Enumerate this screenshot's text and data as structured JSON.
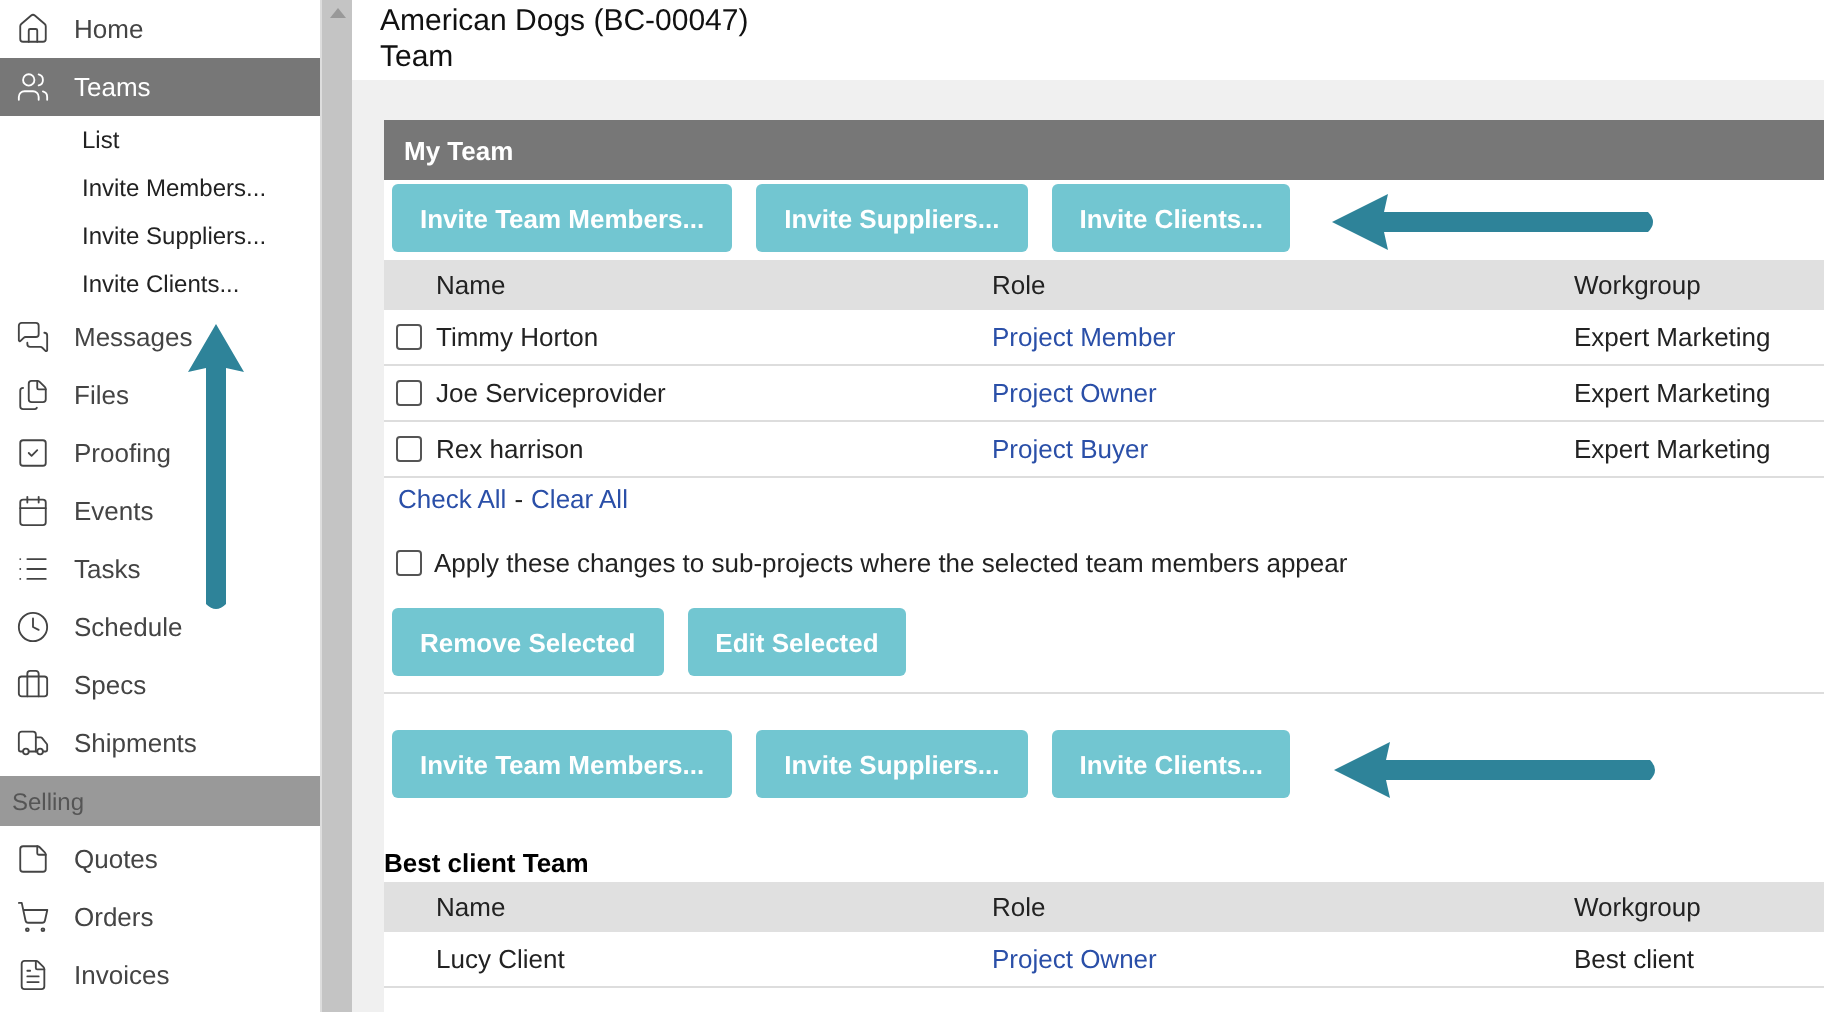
{
  "sidebar": {
    "items": [
      {
        "label": "Home",
        "selected": false
      },
      {
        "label": "Teams",
        "selected": true,
        "children": [
          {
            "label": "List"
          },
          {
            "label": "Invite Members..."
          },
          {
            "label": "Invite Suppliers..."
          },
          {
            "label": "Invite Clients..."
          }
        ]
      },
      {
        "label": "Messages",
        "selected": false
      },
      {
        "label": "Files",
        "selected": false
      },
      {
        "label": "Proofing",
        "selected": false
      },
      {
        "label": "Events",
        "selected": false
      },
      {
        "label": "Tasks",
        "selected": false
      },
      {
        "label": "Schedule",
        "selected": false
      },
      {
        "label": "Specs",
        "selected": false
      },
      {
        "label": "Shipments",
        "selected": false
      }
    ],
    "section": "Selling",
    "section_items": [
      {
        "label": "Quotes",
        "selected": false
      },
      {
        "label": "Orders",
        "selected": false
      },
      {
        "label": "Invoices",
        "selected": false
      }
    ]
  },
  "page": {
    "title": "American Dogs (BC-00047)",
    "subtitle": "Team"
  },
  "my_team": {
    "title": "My Team",
    "invite_buttons": [
      "Invite Team Members...",
      "Invite Suppliers...",
      "Invite Clients..."
    ],
    "columns": [
      "Name",
      "Role",
      "Workgroup"
    ],
    "rows": [
      {
        "name": "Timmy Horton",
        "role": "Project Member",
        "workgroup": "Expert Marketing",
        "checked": false
      },
      {
        "name": "Joe Serviceprovider",
        "role": "Project Owner",
        "workgroup": "Expert Marketing",
        "checked": false
      },
      {
        "name": "Rex harrison",
        "role": "Project Buyer",
        "workgroup": "Expert Marketing",
        "checked": false
      }
    ],
    "check_all": "Check All",
    "separator": "-",
    "clear_all": "Clear All",
    "apply_option": {
      "label": "Apply these changes to sub-projects where the selected team members appear",
      "checked": false
    },
    "action_buttons": [
      "Remove Selected",
      "Edit Selected"
    ],
    "invite_buttons_bottom": [
      "Invite Team Members...",
      "Invite Suppliers...",
      "Invite Clients..."
    ]
  },
  "client_team": {
    "title": "Best client Team",
    "columns": [
      "Name",
      "Role",
      "Workgroup"
    ],
    "rows": [
      {
        "name": "Lucy Client",
        "role": "Project Owner",
        "workgroup": "Best client"
      }
    ]
  }
}
